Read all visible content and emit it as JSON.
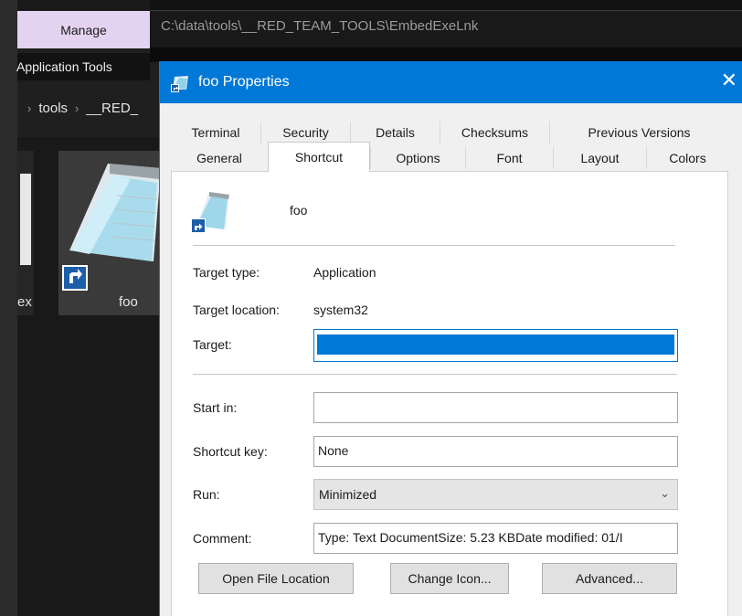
{
  "explorer": {
    "ribbon_tab": "Manage",
    "context_tab": "Application Tools",
    "address_path": "C:\\data\\tools\\__RED_TEAM_TOOLS\\EmbedExeLnk",
    "breadcrumb": [
      "tools",
      "__RED_"
    ],
    "files": [
      {
        "name": "ex"
      },
      {
        "name": "foo"
      }
    ]
  },
  "dialog": {
    "title": "foo Properties",
    "close_glyph": "✕",
    "tabs_row1": [
      "Terminal",
      "Security",
      "Details",
      "Checksums",
      "Previous Versions"
    ],
    "tabs_row2": [
      "General",
      "Shortcut",
      "Options",
      "Font",
      "Layout",
      "Colors"
    ],
    "active_tab": "Shortcut",
    "shortcut": {
      "name": "foo",
      "target_type_label": "Target type:",
      "target_type": "Application",
      "target_location_label": "Target location:",
      "target_location": "system32",
      "target_label": "Target:",
      "target_value": "",
      "start_in_label": "Start in:",
      "start_in": "",
      "shortcut_key_label": "Shortcut key:",
      "shortcut_key": "None",
      "run_label": "Run:",
      "run": "Minimized",
      "comment_label": "Comment:",
      "comment": "Type: Text DocumentSize: 5.23 KBDate modified: 01/I"
    },
    "buttons": {
      "open_location": "Open File Location",
      "change_icon": "Change Icon...",
      "advanced": "Advanced..."
    }
  },
  "colors": {
    "titlebar": "#0078d7",
    "manage_tab": "#e3d3f0"
  }
}
